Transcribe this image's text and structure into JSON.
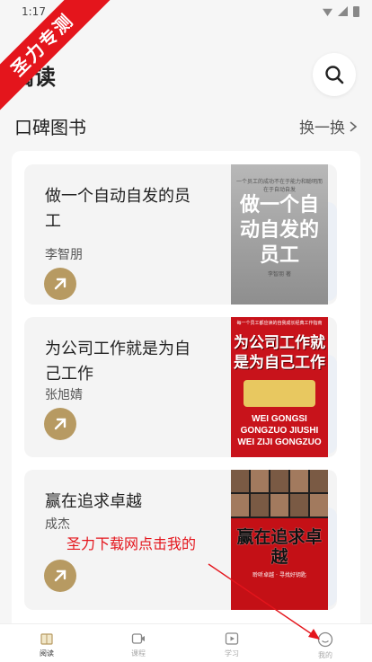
{
  "statusbar": {
    "time": "1:17"
  },
  "watermark": "圣力专测",
  "header": {
    "title": "阅读"
  },
  "section": {
    "title": "口碑图书",
    "refresh_label": "换一换"
  },
  "books": [
    {
      "title": "做一个自动自发的员工",
      "author": "李智朋",
      "cover": {
        "top": "一个员工的成功不在于能力和聪明而在于自动自发",
        "main": "做一个自动自发的员工",
        "foot": "李智朋 著"
      }
    },
    {
      "title": "为公司工作就是为自己工作",
      "author": "张旭婧",
      "cover": {
        "top": "每一个员工都应读的自我成长经典工作指南",
        "main": "为公司工作就是为自己工作",
        "sub": "WEI GONGSI GONGZUO JIUSHI WEI ZIJI GONGZUO"
      }
    },
    {
      "title": "赢在追求卓越",
      "author": "成杰",
      "cover": {
        "main": "赢在追求卓越",
        "foot": "聆听卓越 · 寻找好钥匙"
      }
    }
  ],
  "overlay": {
    "promo_text": "圣力下载网点击我的"
  },
  "tabs": [
    {
      "label": "阅读",
      "icon": "book-icon",
      "active": true
    },
    {
      "label": "课程",
      "icon": "video-icon",
      "active": false
    },
    {
      "label": "学习",
      "icon": "play-icon",
      "active": false
    },
    {
      "label": "我的",
      "icon": "profile-icon",
      "active": false
    }
  ],
  "colors": {
    "accent": "#b79a62",
    "watermark": "#e4151c"
  }
}
